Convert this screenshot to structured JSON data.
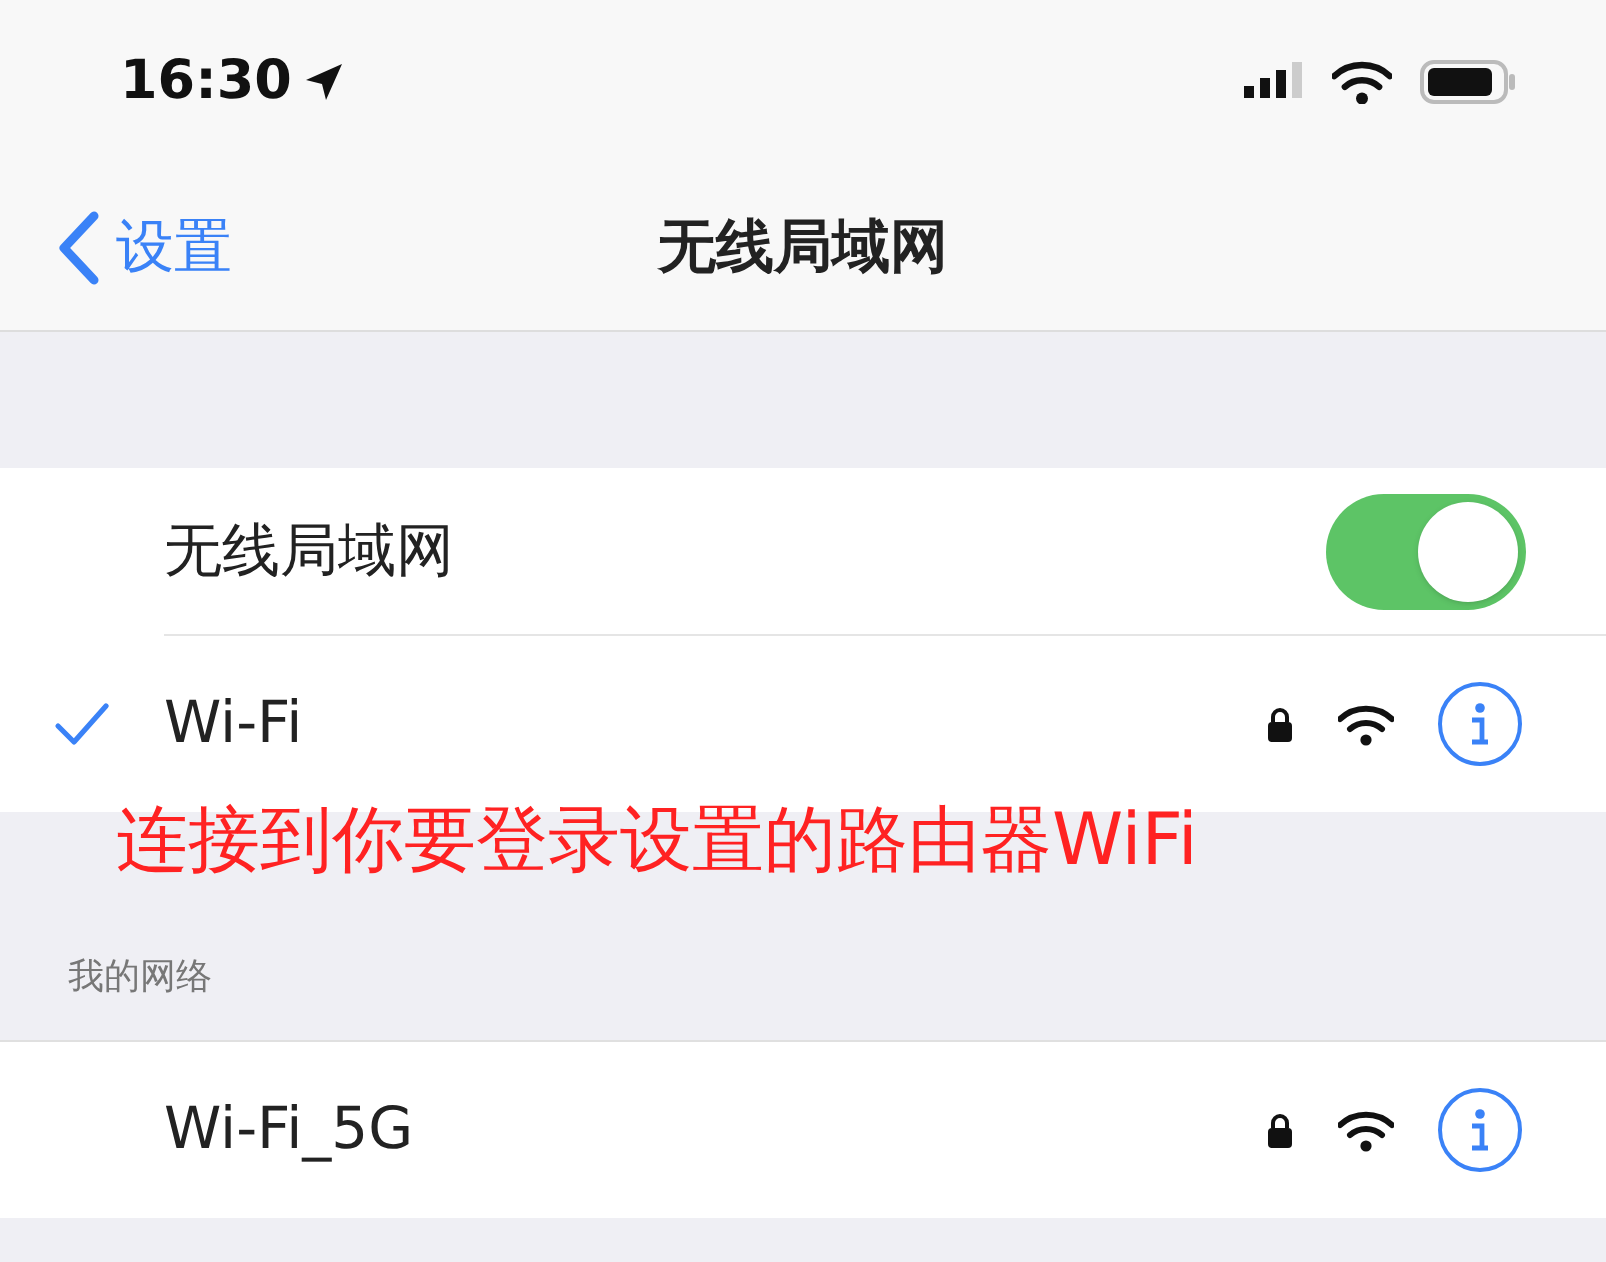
{
  "status_bar": {
    "time": "16:30"
  },
  "nav_bar": {
    "back_label": "设置",
    "title": "无线局域网"
  },
  "wifi_toggle": {
    "label": "无线局域网",
    "on": true
  },
  "current_network": {
    "name": "Wi-Fi",
    "selected": true,
    "locked": true
  },
  "annotation": "连接到你要登录设置的路由器WiFi",
  "section_header": "我的网络",
  "networks": [
    {
      "name": "Wi-Fi_5G",
      "selected": false,
      "locked": true
    }
  ]
}
